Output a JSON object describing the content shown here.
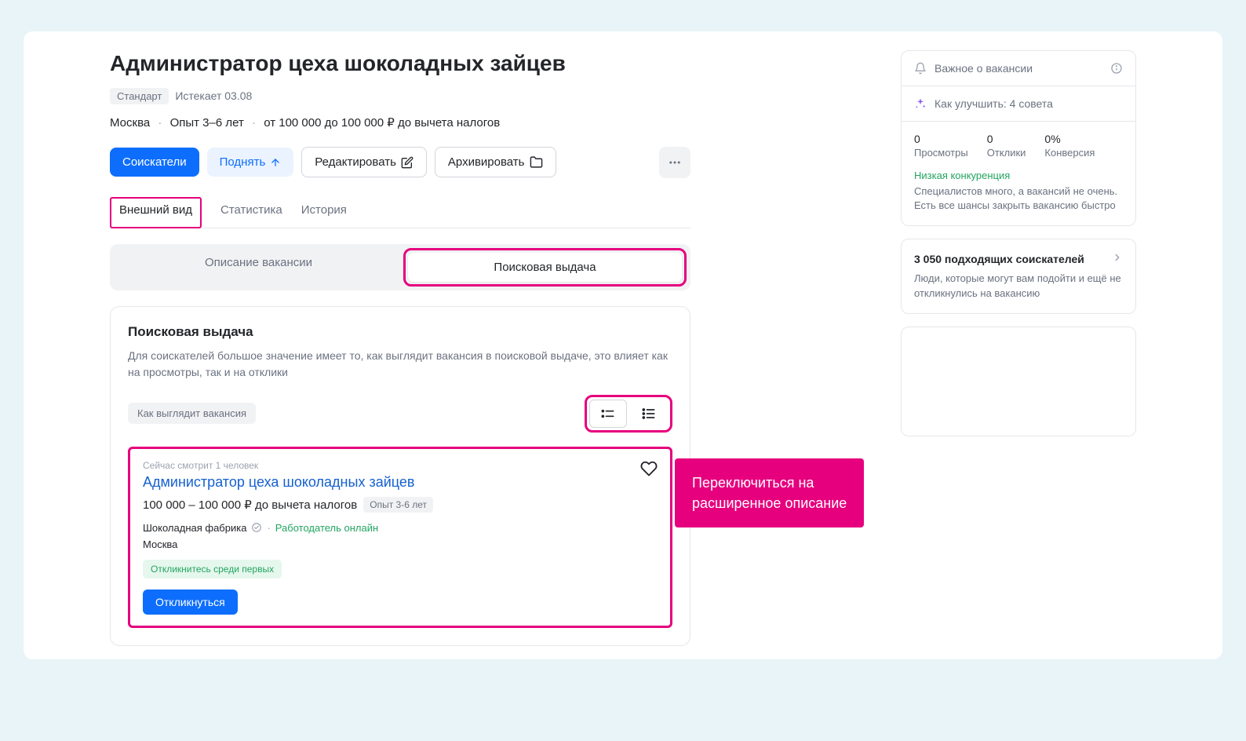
{
  "header": {
    "title": "Администратор цеха шоколадных зайцев",
    "plan_badge": "Стандарт",
    "expires": "Истекает 03.08",
    "location": "Москва",
    "experience": "Опыт 3–6 лет",
    "salary": "от 100 000 до 100 000 ₽ до вычета налогов"
  },
  "actions": {
    "applicants": "Соискатели",
    "promote": "Поднять",
    "edit": "Редактировать",
    "archive": "Архивировать"
  },
  "tabs": {
    "appearance": "Внешний вид",
    "statistics": "Статистика",
    "history": "История"
  },
  "subtabs": {
    "description": "Описание вакансии",
    "search_results": "Поисковая выдача"
  },
  "panel": {
    "title": "Поисковая выдача",
    "description": "Для соискателей большое значение имеет то, как выглядит вакансия в поисковой выдаче, это влияет как на просмотры, так и на отклики",
    "chip": "Как выглядит вакансия"
  },
  "preview": {
    "viewers": "Сейчас смотрит 1 человек",
    "title": "Администратор цеха шоколадных зайцев",
    "salary": "100 000 – 100 000 ₽ до вычета налогов",
    "experience_chip": "Опыт 3-6 лет",
    "company": "Шоколадная фабрика",
    "online": "Работодатель онлайн",
    "city": "Москва",
    "early_badge": "Откликнитесь среди первых",
    "respond": "Откликнуться"
  },
  "sidebar": {
    "important": "Важное о вакансии",
    "improve": "Как улучшить: 4 совета",
    "stats": {
      "views_val": "0",
      "views_lbl": "Просмотры",
      "responses_val": "0",
      "responses_lbl": "Отклики",
      "conversion_val": "0%",
      "conversion_lbl": "Конверсия"
    },
    "competition_title": "Низкая конкуренция",
    "competition_desc": "Специалистов много, а вакансий не очень. Есть все шансы закрыть вакансию быстро",
    "match_title": "3 050 подходящих соискателей",
    "match_desc": "Люди, которые могут вам подойти и ещё не откликнулись на вакансию"
  },
  "callout": {
    "line1": "Переключиться на",
    "line2": "расширенное описание"
  }
}
